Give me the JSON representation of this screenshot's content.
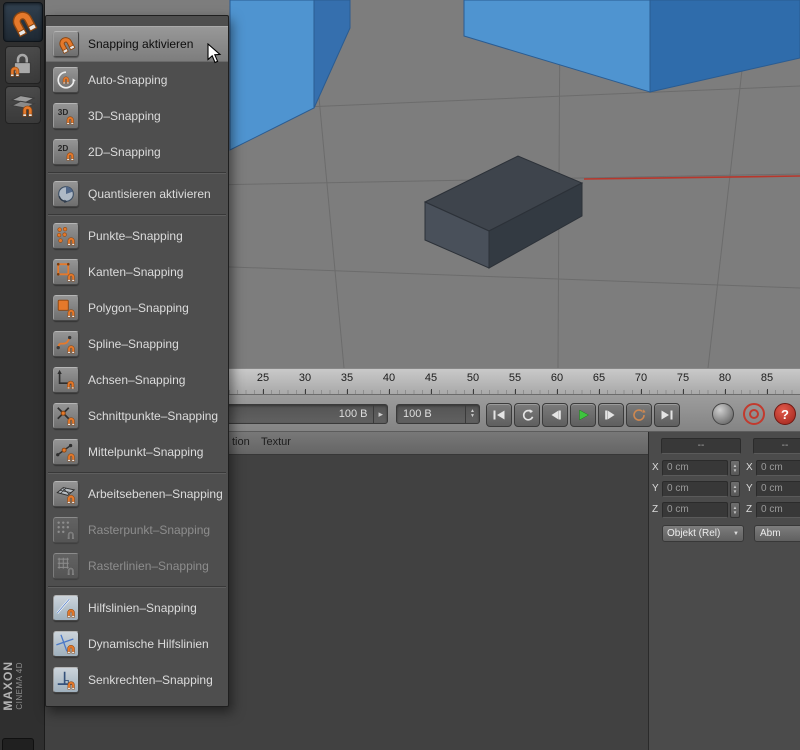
{
  "branding": {
    "maxon": "MAXON",
    "product": "CINEMA 4D"
  },
  "left_toolbar": {
    "icons": [
      {
        "name": "enable-snap-magnet",
        "state": "active"
      },
      {
        "name": "lock-workplane",
        "state": "normal"
      },
      {
        "name": "workplane-layers",
        "state": "normal"
      }
    ]
  },
  "menu": {
    "items": [
      {
        "label": "Snapping aktivieren",
        "icon": "magnet",
        "state": "highlighted"
      },
      {
        "label": "Auto-Snapping",
        "icon": "auto-snapping",
        "state": "normal"
      },
      {
        "label": "3D–Snapping",
        "icon": "3d-snapping",
        "state": "normal"
      },
      {
        "label": "2D–Snapping",
        "icon": "2d-snapping",
        "state": "normal",
        "separator_after": true
      },
      {
        "label": "Quantisieren aktivieren",
        "icon": "quantize",
        "state": "normal",
        "separator_after": true
      },
      {
        "label": "Punkte–Snapping",
        "icon": "point-snap",
        "state": "normal"
      },
      {
        "label": "Kanten–Snapping",
        "icon": "edge-snap",
        "state": "normal"
      },
      {
        "label": "Polygon–Snapping",
        "icon": "polygon-snap",
        "state": "normal"
      },
      {
        "label": "Spline–Snapping",
        "icon": "spline-snap",
        "state": "normal"
      },
      {
        "label": "Achsen–Snapping",
        "icon": "axis-snap",
        "state": "normal"
      },
      {
        "label": "Schnittpunkte–Snapping",
        "icon": "intersection-snap",
        "state": "normal"
      },
      {
        "label": "Mittelpunkt–Snapping",
        "icon": "midpoint-snap",
        "state": "normal",
        "separator_after": true
      },
      {
        "label": "Arbeitsebenen–Snapping",
        "icon": "workplane-snap",
        "state": "normal"
      },
      {
        "label": "Rasterpunkt–Snapping",
        "icon": "gridpoint-snap",
        "state": "disabled"
      },
      {
        "label": "Rasterlinien–Snapping",
        "icon": "gridline-snap",
        "state": "disabled",
        "separator_after": true
      },
      {
        "label": "Hilfslinien–Snapping",
        "icon": "guideline-snap",
        "state": "normal"
      },
      {
        "label": "Dynamische Hilfslinien",
        "icon": "dynamic-guides",
        "state": "normal"
      },
      {
        "label": "Senkrechten–Snapping",
        "icon": "perpendicular-snap",
        "state": "normal"
      }
    ]
  },
  "timeline": {
    "ticks": [
      "25",
      "30",
      "35",
      "40",
      "45",
      "50",
      "55",
      "60",
      "65",
      "70",
      "75",
      "80",
      "85"
    ]
  },
  "transport": {
    "frame_popup_value": "100 B",
    "max_frame_value": "100 B",
    "buttons": [
      {
        "name": "goto-start"
      },
      {
        "name": "play-reverse"
      },
      {
        "name": "previous-frame"
      },
      {
        "name": "play-forward"
      },
      {
        "name": "next-frame"
      },
      {
        "name": "loop-playback"
      },
      {
        "name": "goto-end"
      }
    ],
    "help_glyph": "?"
  },
  "attribute_panel": {
    "tabs": [
      {
        "label": "tion"
      },
      {
        "label": "Textur"
      }
    ]
  },
  "coordinates_panel": {
    "top_left_value": "--",
    "top_right_value": "--",
    "left": {
      "x_label": "X",
      "x": "0 cm",
      "y_label": "Y",
      "y": "0 cm",
      "z_label": "Z",
      "z": "0 cm"
    },
    "right": {
      "x_label": "X",
      "x": "0 cm",
      "y_label": "Y",
      "y": "0 cm",
      "z_label": "Z",
      "z": "0 cm"
    },
    "mode_dropdown": "Objekt (Rel)",
    "partial_button": "Abm"
  },
  "icons": {
    "popup_arrow": "▸",
    "stepper_up": "▲",
    "stepper_down": "▼",
    "dropdown_arrow": "▼"
  },
  "colors": {
    "accent_orange": "#e5792b",
    "block_blue": "#4f94d0",
    "axis_red": "#b8372c",
    "play_green": "#3fc43f",
    "record_red": "#c23a2e"
  }
}
